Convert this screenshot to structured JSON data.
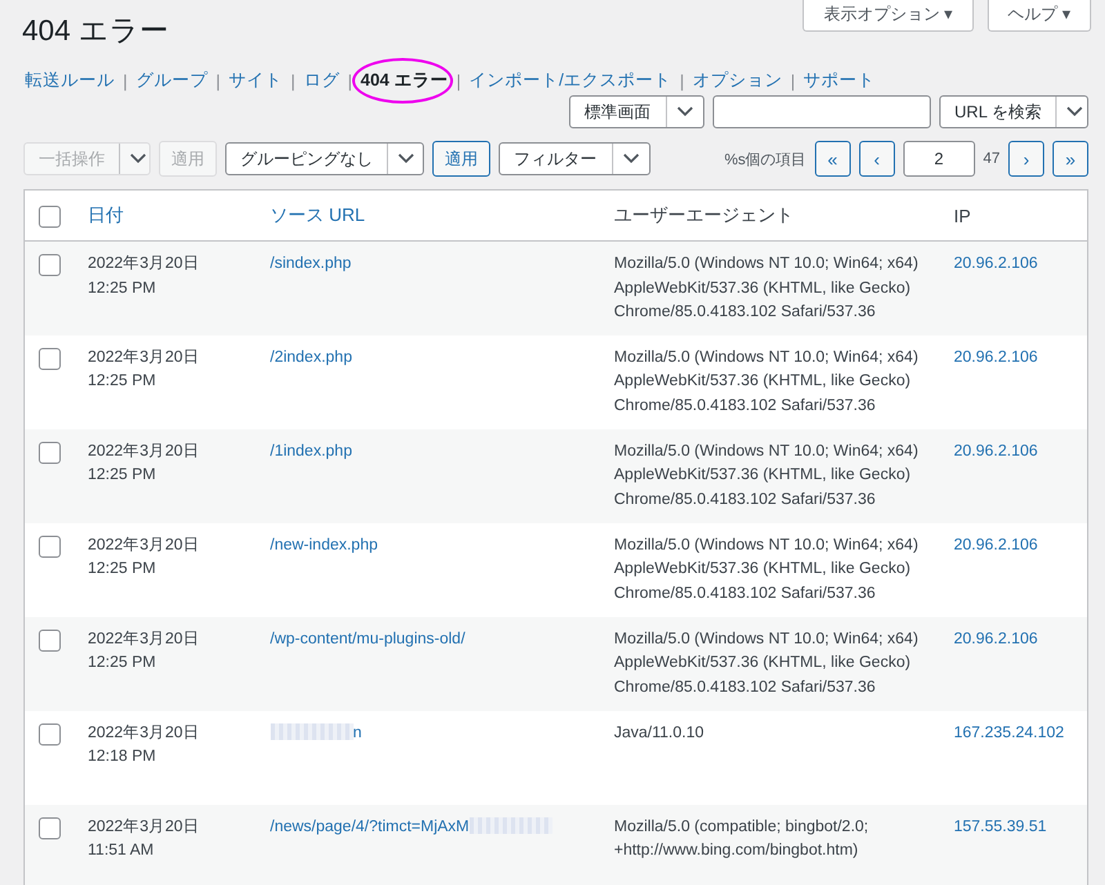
{
  "screen_options": [
    {
      "label": "表示オプション ▾"
    },
    {
      "label": "ヘルプ ▾"
    }
  ],
  "title": "404 エラー",
  "nav": [
    {
      "label": "転送ルール",
      "selected": false,
      "circled": false
    },
    {
      "separator": "|",
      "label": "グループ",
      "selected": false,
      "circled": false
    },
    {
      "separator": "|",
      "label": "サイト",
      "selected": false,
      "circled": false
    },
    {
      "separator": "|",
      "label": "ログ",
      "selected": false,
      "circled": false
    },
    {
      "separator": "|",
      "label": "404 エラー",
      "selected": true,
      "circled": true
    },
    {
      "separator": "|",
      "label": "インポート/エクスポート",
      "selected": false,
      "circled": false
    },
    {
      "separator": "|",
      "label": "オプション",
      "selected": false,
      "circled": false
    },
    {
      "separator": "|",
      "label": "サポート",
      "selected": false,
      "circled": false
    }
  ],
  "search": {
    "view_select": "標準画面",
    "search_button": "URL を検索"
  },
  "tablenav": {
    "bulk_action": {
      "label": "一括操作",
      "disabled": true
    },
    "apply_1": {
      "label": "適用",
      "disabled": true
    },
    "grouping": {
      "label": "グルーピングなし",
      "disabled": false
    },
    "apply_2": {
      "label": "適用",
      "disabled": false
    },
    "filter": {
      "label": "フィルター",
      "disabled": false
    },
    "items_count": "%s個の項目",
    "pagination": {
      "first": "«",
      "prev": "‹",
      "current_page": "2",
      "total_pages": "47",
      "next": "›",
      "last": "»"
    }
  },
  "table": {
    "columns": [
      "日付",
      "ソース URL",
      "ユーザーエージェント",
      "IP"
    ],
    "header_checked": false,
    "rows": [
      {
        "checked": false,
        "date": "2022年3月20日",
        "time": "12:25 PM",
        "url": "/sindex.php",
        "agent": "Mozilla/5.0 (Windows NT 10.0; Win64; x64) AppleWebKit/537.36 (KHTML, like Gecko) Chrome/85.0.4183.102 Safari/537.36",
        "ip": "20.96.2.106"
      },
      {
        "checked": false,
        "date": "2022年3月20日",
        "time": "12:25 PM",
        "url": "/2index.php",
        "agent": "Mozilla/5.0 (Windows NT 10.0; Win64; x64) AppleWebKit/537.36 (KHTML, like Gecko) Chrome/85.0.4183.102 Safari/537.36",
        "ip": "20.96.2.106"
      },
      {
        "checked": false,
        "date": "2022年3月20日",
        "time": "12:25 PM",
        "url": "/1index.php",
        "agent": "Mozilla/5.0 (Windows NT 10.0; Win64; x64) AppleWebKit/537.36 (KHTML, like Gecko) Chrome/85.0.4183.102 Safari/537.36",
        "ip": "20.96.2.106"
      },
      {
        "checked": false,
        "date": "2022年3月20日",
        "time": "12:25 PM",
        "url": "/new-index.php",
        "agent": "Mozilla/5.0 (Windows NT 10.0; Win64; x64) AppleWebKit/537.36 (KHTML, like Gecko) Chrome/85.0.4183.102 Safari/537.36",
        "ip": "20.96.2.106"
      },
      {
        "checked": false,
        "date": "2022年3月20日",
        "time": "12:25 PM",
        "url": "/wp-content/mu-plugins-old/",
        "agent": "Mozilla/5.0 (Windows NT 10.0; Win64; x64) AppleWebKit/537.36 (KHTML, like Gecko) Chrome/85.0.4183.102 Safari/537.36",
        "ip": "20.96.2.106"
      },
      {
        "checked": false,
        "date": "2022年3月20日",
        "time": "12:18 PM",
        "url": "n",
        "redacted_prefix": true,
        "agent": "Java/11.0.10",
        "ip": "167.235.24.102"
      },
      {
        "checked": false,
        "date": "2022年3月20日",
        "time": "11:51 AM",
        "url": "/news/page/4/?timct=MjAxM",
        "redacted_suffix": true,
        "agent": "Mozilla/5.0 (compatible; bingbot/2.0; +http://www.bing.com/bingbot.htm)",
        "ip": "157.55.39.51"
      }
    ]
  }
}
